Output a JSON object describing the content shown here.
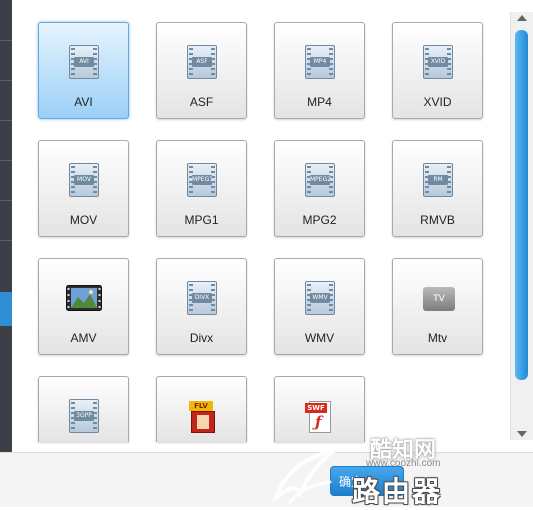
{
  "formats": [
    {
      "label": "AVI",
      "badge": "AVI",
      "icon": "avi-film-icon",
      "selected": true
    },
    {
      "label": "ASF",
      "badge": "ASF",
      "icon": "asf-film-icon"
    },
    {
      "label": "MP4",
      "badge": "MP4",
      "icon": "mp4-film-icon"
    },
    {
      "label": "XVID",
      "badge": "XVID",
      "icon": "xvid-film-icon"
    },
    {
      "label": "MOV",
      "badge": "MOV",
      "icon": "mov-film-icon"
    },
    {
      "label": "MPG1",
      "badge": "MPEG1",
      "icon": "mpg1-film-icon"
    },
    {
      "label": "MPG2",
      "badge": "MPEG2",
      "icon": "mpg2-film-icon"
    },
    {
      "label": "RMVB",
      "badge": "RM",
      "icon": "rmvb-film-icon"
    },
    {
      "label": "AMV",
      "badge": "",
      "icon": "amv-landscape-film-icon"
    },
    {
      "label": "Divx",
      "badge": "DIVX",
      "icon": "divx-film-icon"
    },
    {
      "label": "WMV",
      "badge": "WMV",
      "icon": "wmv-film-icon"
    },
    {
      "label": "Mtv",
      "badge": "TV",
      "icon": "apple-tv-icon"
    },
    {
      "label": "",
      "badge": "3GPP",
      "icon": "3gpp-film-icon"
    },
    {
      "label": "",
      "badge": "FLV",
      "icon": "flv-film-icon"
    },
    {
      "label": "",
      "badge": "SWF",
      "icon": "swf-flash-document-icon"
    }
  ],
  "footer": {
    "ok_label": "确定"
  },
  "watermark": {
    "site_name": "酷知网",
    "url": "www.coozhi.com",
    "logo_text": "路由器"
  },
  "colors": {
    "accent": "#2f8fd4",
    "selected_tile": "#9bd0f6",
    "scroll_thumb": "#1e8ad6"
  }
}
